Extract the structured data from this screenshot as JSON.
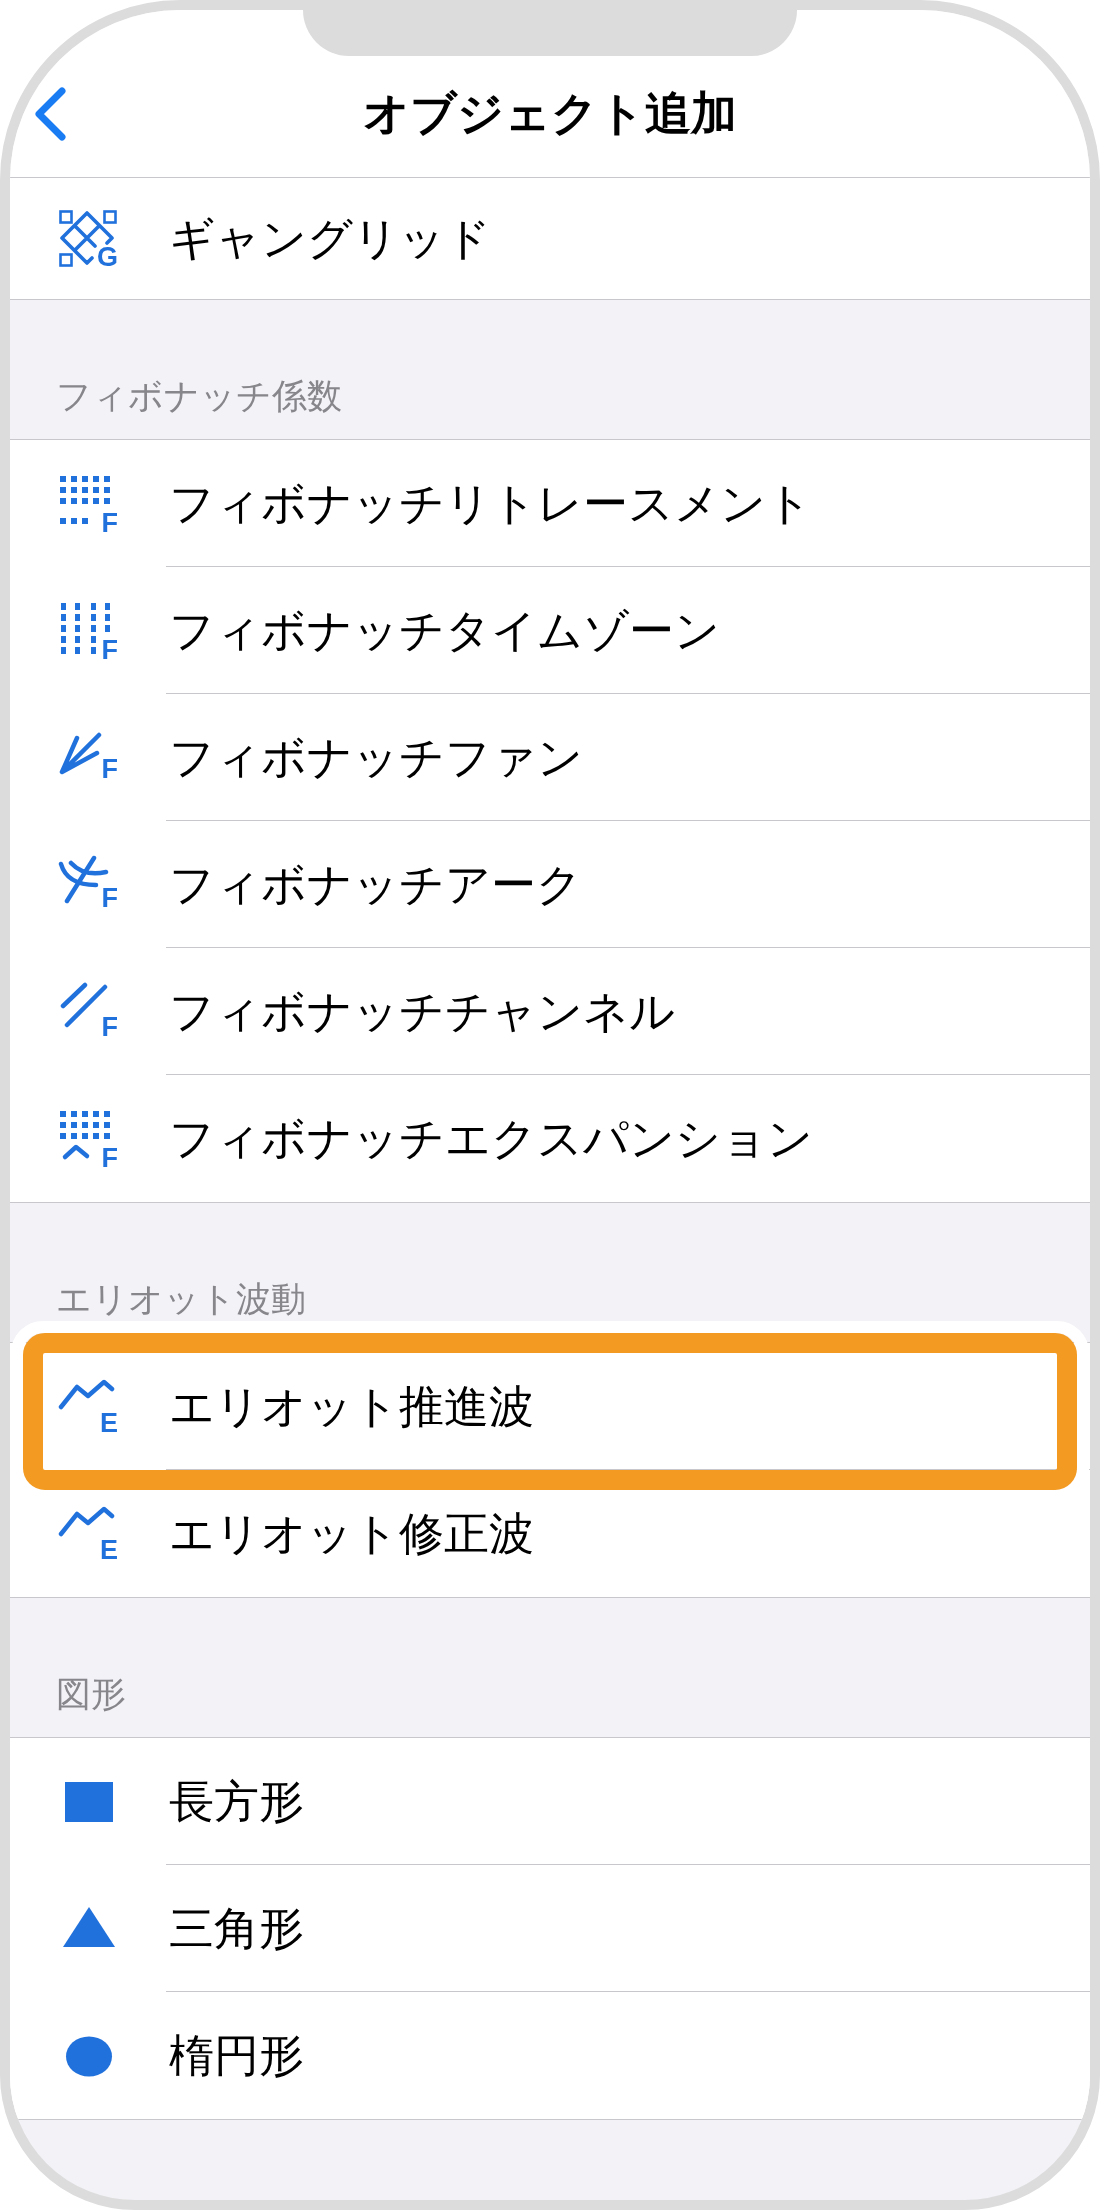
{
  "nav_bar": {
    "title": "オブジェクト追加"
  },
  "sections": [
    {
      "items": [
        {
          "kind": "gann",
          "icon_letter": "G",
          "label": "ギャングリッド",
          "highlighted": false
        }
      ]
    },
    {
      "header": "フィボナッチ係数",
      "items": [
        {
          "kind": "retracement",
          "icon_letter": "F",
          "label": "フィボナッチリトレースメント",
          "highlighted": false
        },
        {
          "kind": "timezones",
          "icon_letter": "F",
          "label": "フィボナッチタイムゾーン",
          "highlighted": false
        },
        {
          "kind": "fan",
          "icon_letter": "F",
          "label": "フィボナッチファン",
          "highlighted": false
        },
        {
          "kind": "arcs",
          "icon_letter": "F",
          "label": "フィボナッチアーク",
          "highlighted": false
        },
        {
          "kind": "channel",
          "icon_letter": "F",
          "label": "フィボナッチチャンネル",
          "highlighted": false
        },
        {
          "kind": "expansion",
          "icon_letter": "F",
          "label": "フィボナッチエクスパンション",
          "highlighted": false
        }
      ]
    },
    {
      "header": "エリオット波動",
      "items": [
        {
          "kind": "wave",
          "icon_letter": "E",
          "label": "エリオット推進波",
          "highlighted": true
        },
        {
          "kind": "wave",
          "icon_letter": "E",
          "label": "エリオット修正波",
          "highlighted": false
        }
      ]
    },
    {
      "header": "図形",
      "items": [
        {
          "kind": "rectangle",
          "label": "長方形",
          "highlighted": false
        },
        {
          "kind": "triangle",
          "label": "三角形",
          "highlighted": false
        },
        {
          "kind": "ellipse",
          "label": "楕円形",
          "highlighted": false
        }
      ]
    }
  ]
}
